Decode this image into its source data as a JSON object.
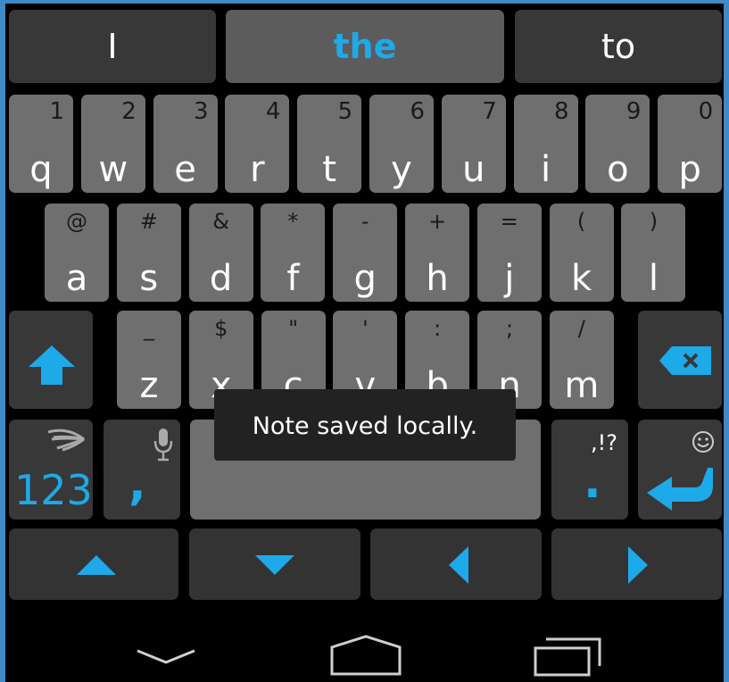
{
  "suggestions": [
    "I",
    "the",
    "to"
  ],
  "row1": [
    {
      "letter": "q",
      "hint": "1"
    },
    {
      "letter": "w",
      "hint": "2"
    },
    {
      "letter": "e",
      "hint": "3"
    },
    {
      "letter": "r",
      "hint": "4"
    },
    {
      "letter": "t",
      "hint": "5"
    },
    {
      "letter": "y",
      "hint": "6"
    },
    {
      "letter": "u",
      "hint": "7"
    },
    {
      "letter": "i",
      "hint": "8"
    },
    {
      "letter": "o",
      "hint": "9"
    },
    {
      "letter": "p",
      "hint": "0"
    }
  ],
  "row2": [
    {
      "letter": "a",
      "hint": "@"
    },
    {
      "letter": "s",
      "hint": "#"
    },
    {
      "letter": "d",
      "hint": "&"
    },
    {
      "letter": "f",
      "hint": "*"
    },
    {
      "letter": "g",
      "hint": "-"
    },
    {
      "letter": "h",
      "hint": "+"
    },
    {
      "letter": "j",
      "hint": "="
    },
    {
      "letter": "k",
      "hint": "("
    },
    {
      "letter": "l",
      "hint": ")"
    }
  ],
  "row3": [
    {
      "letter": "z",
      "hint": "_"
    },
    {
      "letter": "x",
      "hint": "$"
    },
    {
      "letter": "c",
      "hint": "\""
    },
    {
      "letter": "v",
      "hint": "'"
    },
    {
      "letter": "b",
      "hint": ":"
    },
    {
      "letter": "n",
      "hint": ";"
    },
    {
      "letter": "m",
      "hint": "/"
    }
  ],
  "bottom": {
    "numbers_label": "123",
    "comma_label": ",",
    "period_label": ".",
    "punct_hint": ",!?"
  },
  "toast": "Note saved locally.",
  "icons": {
    "shift": "shift-arrow",
    "backspace": "backspace",
    "swype_logo": "swype-logo",
    "mic": "microphone",
    "smiley": "smiley",
    "enter": "enter-arrow",
    "up": "caret-up",
    "down": "caret-down",
    "left": "caret-left",
    "right": "caret-right",
    "nav_back": "nav-back-chevron",
    "nav_home": "nav-home",
    "nav_recent": "nav-recent-apps"
  },
  "colors": {
    "accent": "#1ea9e8",
    "key_light": "#6f6f6f",
    "key_dark": "#383838",
    "frame": "#3f89c6"
  }
}
